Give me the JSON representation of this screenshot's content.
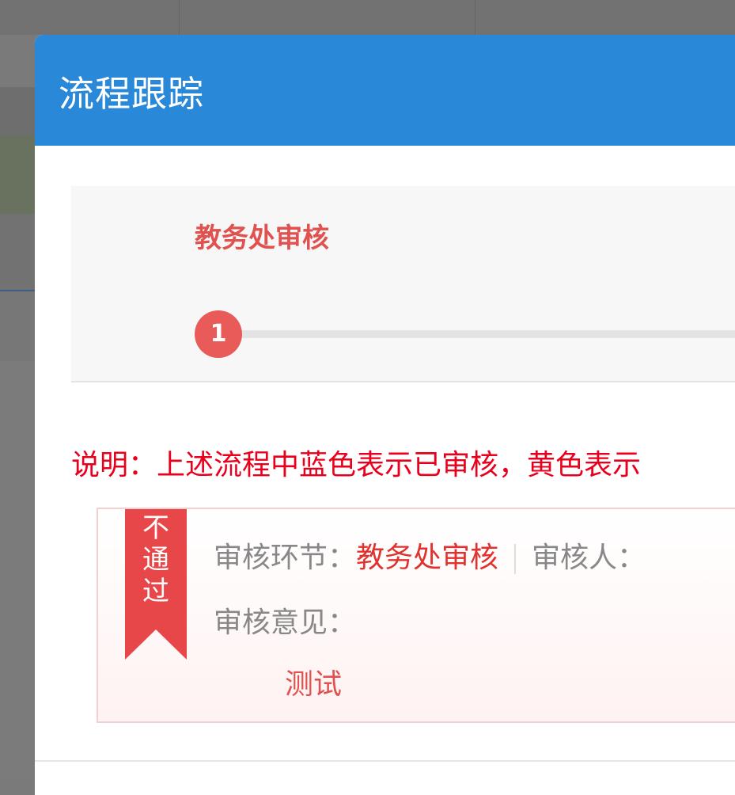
{
  "dialog": {
    "title": "流程跟踪"
  },
  "steps": {
    "items": [
      {
        "label": "教务处审核",
        "number": "1"
      }
    ]
  },
  "note": {
    "text": "说明：上述流程中蓝色表示已审核，黄色表示"
  },
  "result": {
    "status_badge": [
      "不",
      "通",
      "过"
    ],
    "stage_label": "审核环节：",
    "stage_value": "教务处审核",
    "reviewer_label": "审核人：",
    "opinion_label": "审核意见：",
    "opinion_value": "测试"
  },
  "colors": {
    "header": "#2a88d8",
    "accent_red": "#e8474a",
    "note_red": "#e8001c"
  }
}
